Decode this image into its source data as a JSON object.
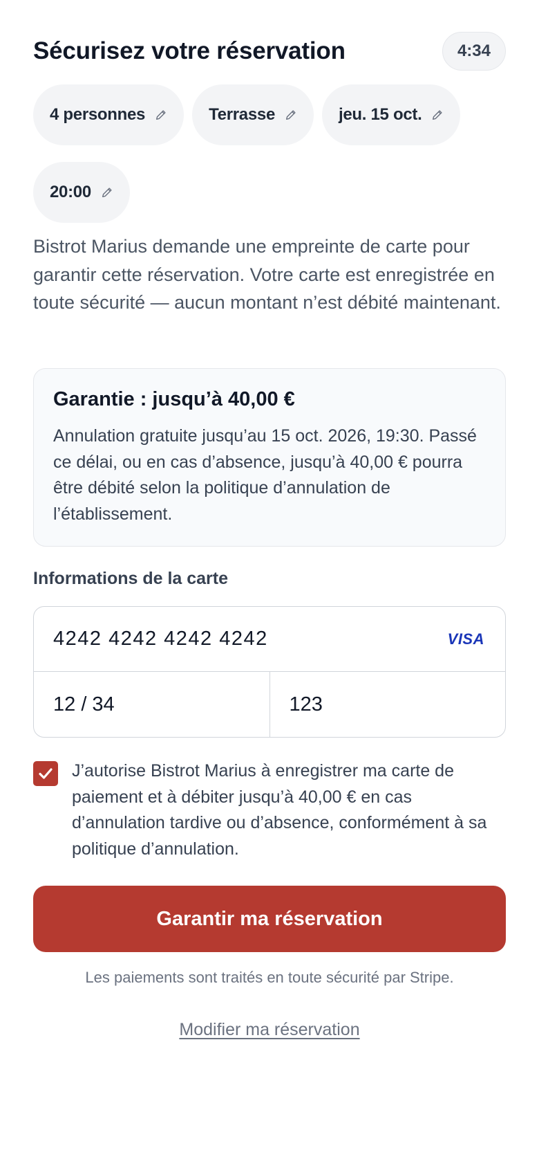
{
  "header": {
    "title": "Sécurisez votre réservation",
    "timer": "4:34"
  },
  "chips": [
    {
      "label": "4 personnes",
      "icon": "pencil-icon"
    },
    {
      "label": "Terrasse",
      "icon": "pencil-icon"
    },
    {
      "label": "jeu. 15 oct.",
      "icon": "pencil-icon"
    },
    {
      "label": "20:00",
      "icon": "pencil-icon"
    }
  ],
  "description": "Bistrot Marius demande une empreinte de carte pour garantir cette réservation. Votre carte est enregistrée en toute sécurité — aucun montant n’est débité maintenant.",
  "guarantee": {
    "title": "Garantie : jusqu’à 40,00 €",
    "body": "Annulation gratuite jusqu’au 15 oct. 2026, 19:30. Passé ce délai, ou en cas d’absence, jusqu’à 40,00 € pourra être débité selon la politique d’annulation de l’établissement."
  },
  "card": {
    "label": "Informations de la carte",
    "number": "4242 4242 4242 4242",
    "brand": "VISA",
    "expiry": "12 / 34",
    "cvc": "123"
  },
  "consent": {
    "checked": true,
    "text": "J’autorise Bistrot Marius à enregistrer ma carte de paiement et à débiter jusqu’à 40,00 € en cas d’annulation tardive ou d’absence, conformément à sa politique d’annulation."
  },
  "cta_label": "Garantir ma réservation",
  "stripe_note": "Les paiements sont traités en toute sécurité par Stripe.",
  "modify_link": "Modifier ma réservation",
  "colors": {
    "accent": "#b53a30",
    "visa": "#1a36b8"
  }
}
